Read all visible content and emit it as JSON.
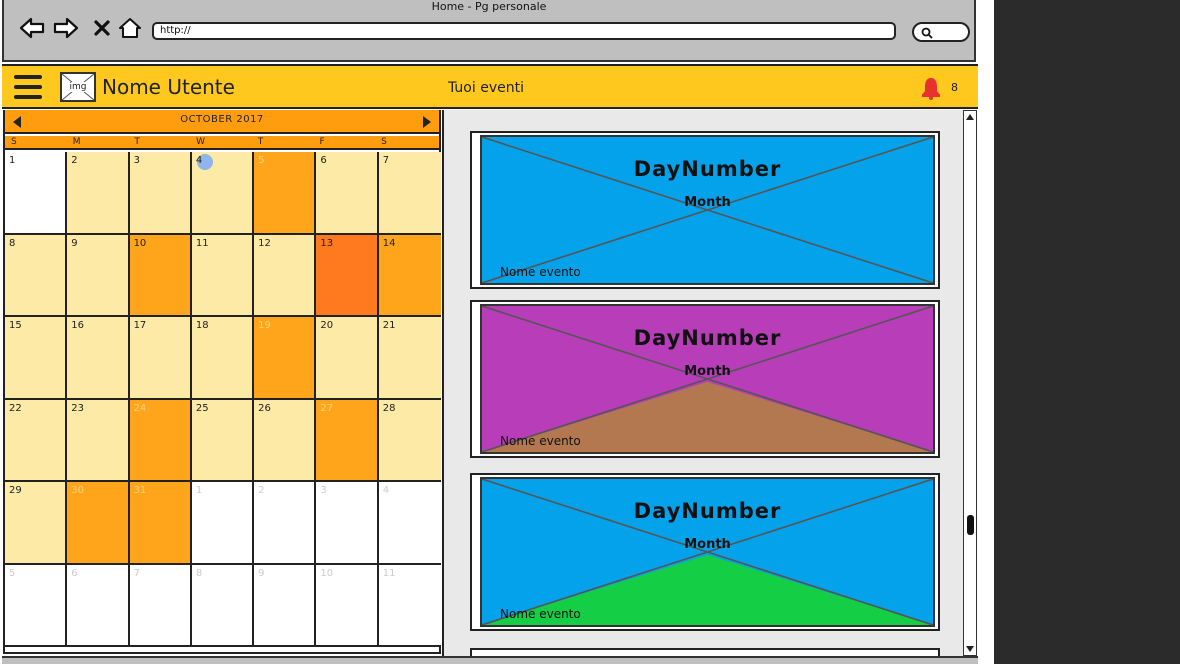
{
  "browser": {
    "window_title": "Home - Pg personale",
    "url": "http://"
  },
  "header": {
    "avatar_label": "img",
    "username": "Nome Utente",
    "section_title": "Tuoi eventi",
    "notification_count": "8"
  },
  "calendar": {
    "month_label": "OCTOBER 2017",
    "weekdays": [
      "S",
      "M",
      "T",
      "W",
      "T",
      "F",
      "S"
    ],
    "cells": [
      {
        "n": "1",
        "s": "white"
      },
      {
        "n": "2",
        "s": "light"
      },
      {
        "n": "3",
        "s": "light"
      },
      {
        "n": "4",
        "s": "light",
        "today": true
      },
      {
        "n": "5",
        "s": "event"
      },
      {
        "n": "6",
        "s": "light"
      },
      {
        "n": "7",
        "s": "light"
      },
      {
        "n": "8",
        "s": "light"
      },
      {
        "n": "9",
        "s": "light"
      },
      {
        "n": "10",
        "s": "event"
      },
      {
        "n": "11",
        "s": "light"
      },
      {
        "n": "12",
        "s": "light"
      },
      {
        "n": "13",
        "s": "hot"
      },
      {
        "n": "14",
        "s": "event"
      },
      {
        "n": "15",
        "s": "light"
      },
      {
        "n": "16",
        "s": "light"
      },
      {
        "n": "17",
        "s": "light"
      },
      {
        "n": "18",
        "s": "light"
      },
      {
        "n": "19",
        "s": "event"
      },
      {
        "n": "20",
        "s": "light"
      },
      {
        "n": "21",
        "s": "light"
      },
      {
        "n": "22",
        "s": "light"
      },
      {
        "n": "23",
        "s": "light"
      },
      {
        "n": "24",
        "s": "event"
      },
      {
        "n": "25",
        "s": "light"
      },
      {
        "n": "26",
        "s": "light"
      },
      {
        "n": "27",
        "s": "event"
      },
      {
        "n": "28",
        "s": "light"
      },
      {
        "n": "29",
        "s": "light"
      },
      {
        "n": "30",
        "s": "event"
      },
      {
        "n": "31",
        "s": "event"
      },
      {
        "n": "1",
        "s": "white",
        "other": true
      },
      {
        "n": "2",
        "s": "white",
        "other": true
      },
      {
        "n": "3",
        "s": "white",
        "other": true
      },
      {
        "n": "4",
        "s": "white",
        "other": true
      },
      {
        "n": "5",
        "s": "white",
        "other": true
      },
      {
        "n": "6",
        "s": "white",
        "other": true
      },
      {
        "n": "7",
        "s": "white",
        "other": true
      },
      {
        "n": "8",
        "s": "white",
        "other": true
      },
      {
        "n": "9",
        "s": "white",
        "other": true
      },
      {
        "n": "10",
        "s": "white",
        "other": true
      },
      {
        "n": "11",
        "s": "white",
        "other": true
      }
    ]
  },
  "events": [
    {
      "day": "DayNumber",
      "month": "Month",
      "name": "Nome evento",
      "bg": "#04a2eb",
      "triangle": "none"
    },
    {
      "day": "DayNumber",
      "month": "Month",
      "name": "Nome evento",
      "bg": "#b83db8",
      "triangle": "#b47850"
    },
    {
      "day": "DayNumber",
      "month": "Month",
      "name": "Nome evento",
      "bg": "#04a2eb",
      "triangle": "#14cf45"
    }
  ],
  "colors": {
    "header_bg": "#ffc81e",
    "calendar_event": "#ffa51c",
    "calendar_light": "#fdeaa6",
    "calendar_highlight": "#ff7a1e",
    "bell": "#e8322d"
  }
}
